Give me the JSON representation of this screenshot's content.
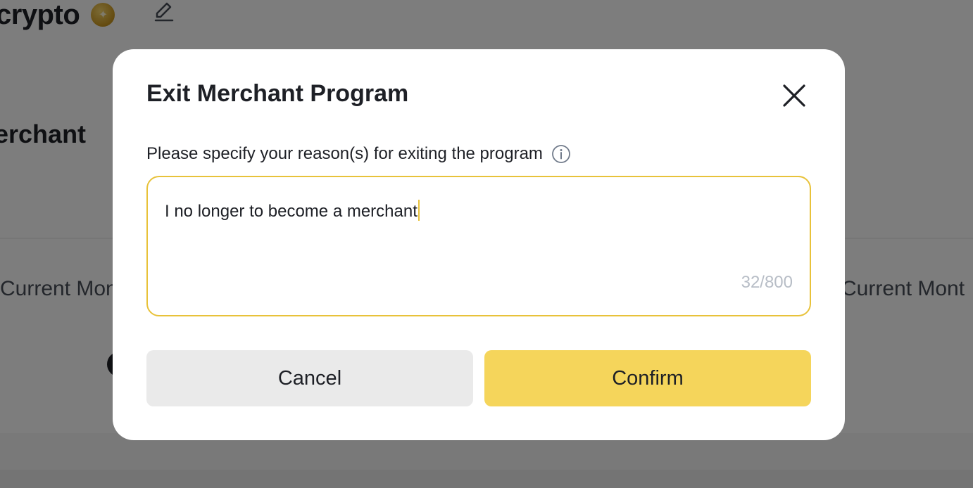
{
  "background": {
    "username": "crypto",
    "section_title": "erchant",
    "current_month_left": "Current Mon",
    "current_month_right": "Current Mont",
    "badge_icon": "gold-star-badge-icon",
    "edit_icon": "pencil-edit-icon"
  },
  "modal": {
    "title": "Exit Merchant Program",
    "reason_label": "Please specify your reason(s) for exiting the program",
    "reason_value": "I no longer to become a merchant",
    "char_count": "32/800",
    "cancel_label": "Cancel",
    "confirm_label": "Confirm",
    "close_icon": "close-icon",
    "info_icon": "info-icon"
  },
  "colors": {
    "accent_yellow": "#f5d55b",
    "input_border": "#e8c23a",
    "text_primary": "#1e2026",
    "overlay": "rgba(0,0,0,0.5)"
  }
}
